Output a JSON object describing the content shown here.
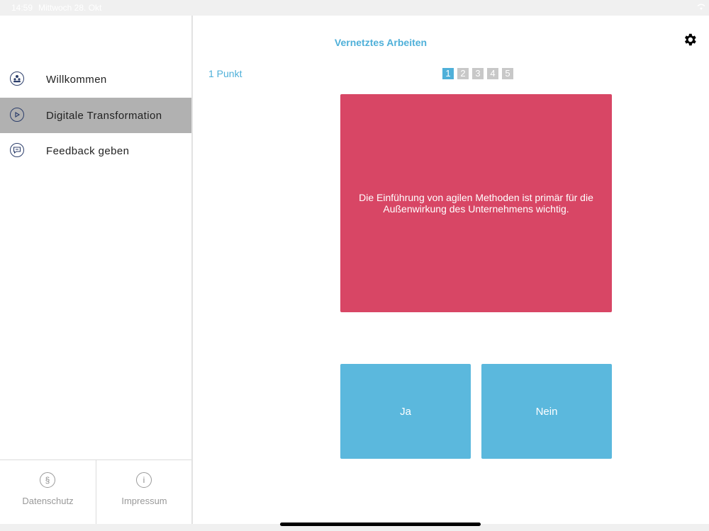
{
  "status_bar": {
    "time": "14:59",
    "date": "Mittwoch 28. Okt"
  },
  "sidebar": {
    "items": [
      {
        "label": "Willkommen",
        "icon": "people-icon"
      },
      {
        "label": "Digitale Transformation",
        "icon": "play-icon",
        "active": true
      },
      {
        "label": "Feedback geben",
        "icon": "speech-bubble-icon"
      }
    ],
    "footer": [
      {
        "label": "Datenschutz",
        "icon_glyph": "§"
      },
      {
        "label": "Impressum",
        "icon_glyph": "i"
      }
    ]
  },
  "main": {
    "title": "Vernetztes Arbeiten",
    "points": "1 Punkt",
    "pages": [
      "1",
      "2",
      "3",
      "4",
      "5"
    ],
    "current_page": "1",
    "question": "Die Einführung von agilen Methoden ist primär für die Außenwirkung des Unternehmens wichtig.",
    "answers": {
      "yes": "Ja",
      "no": "Nein"
    }
  },
  "colors": {
    "accent": "#4fb0d9",
    "card": "#d84665",
    "answer": "#5bb8dd",
    "active_nav": "#b1b1b1"
  }
}
